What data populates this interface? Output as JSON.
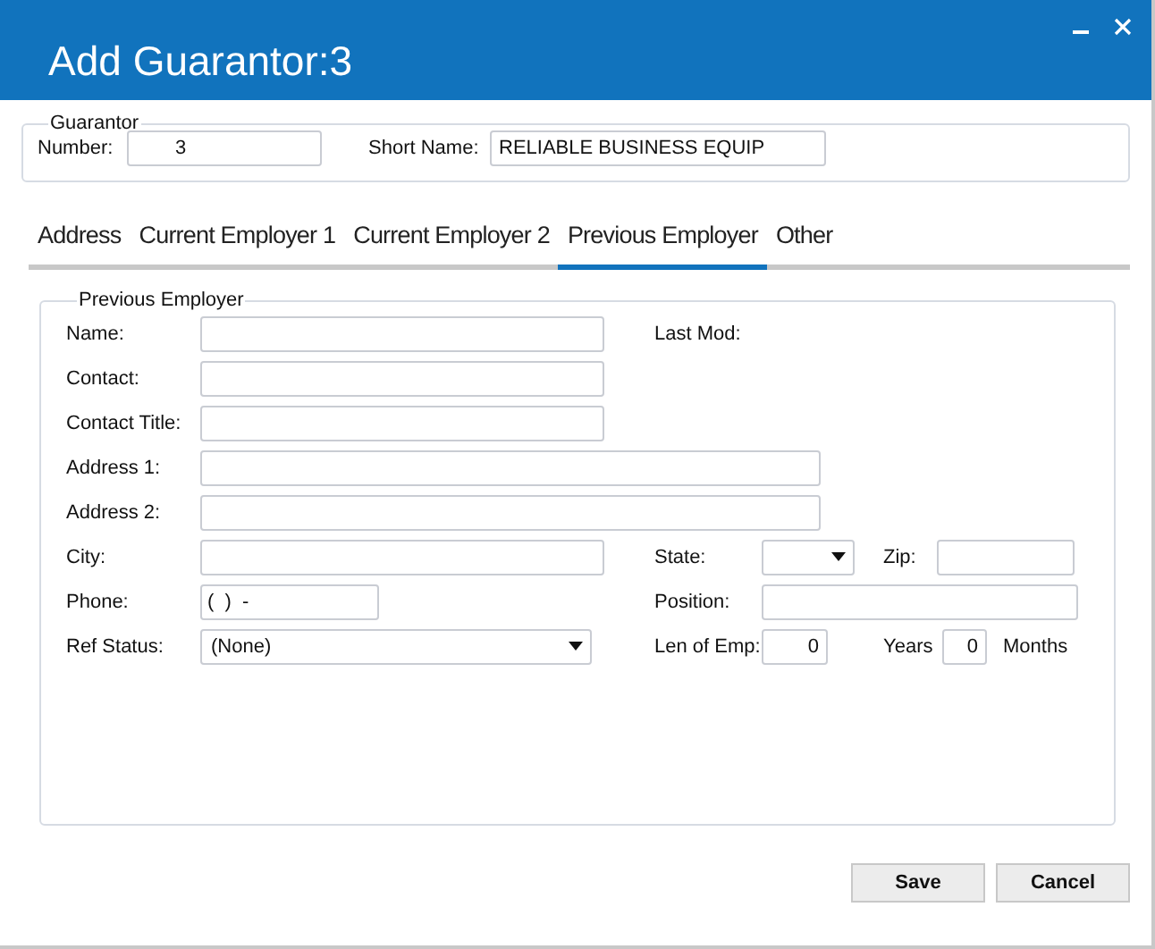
{
  "window": {
    "title": "Add Guarantor:3"
  },
  "guarantor": {
    "legend": "Guarantor",
    "number_label": "Number:",
    "number": "3",
    "short_name_label": "Short Name:",
    "short_name": "RELIABLE BUSINESS EQUIP"
  },
  "tabs": [
    {
      "label": "Address",
      "selected": false
    },
    {
      "label": "Current Employer 1",
      "selected": false
    },
    {
      "label": "Current Employer 2",
      "selected": false
    },
    {
      "label": "Previous Employer",
      "selected": true
    },
    {
      "label": "Other",
      "selected": false
    }
  ],
  "previous_employer": {
    "legend": "Previous Employer",
    "name_label": "Name:",
    "last_mod_label": "Last Mod:",
    "contact_label": "Contact:",
    "contact_title_label": "Contact Title:",
    "address1_label": "Address 1:",
    "address2_label": "Address 2:",
    "city_label": "City:",
    "state_label": "State:",
    "zip_label": "Zip:",
    "phone_label": "Phone:",
    "phone": "(  )  -",
    "position_label": "Position:",
    "ref_status_label": "Ref Status:",
    "ref_status": "(None)",
    "len_of_emp_label": "Len of Emp:",
    "years": "0",
    "years_label": "Years",
    "months": "0",
    "months_label": "Months"
  },
  "buttons": [
    "Save",
    "Cancel"
  ]
}
